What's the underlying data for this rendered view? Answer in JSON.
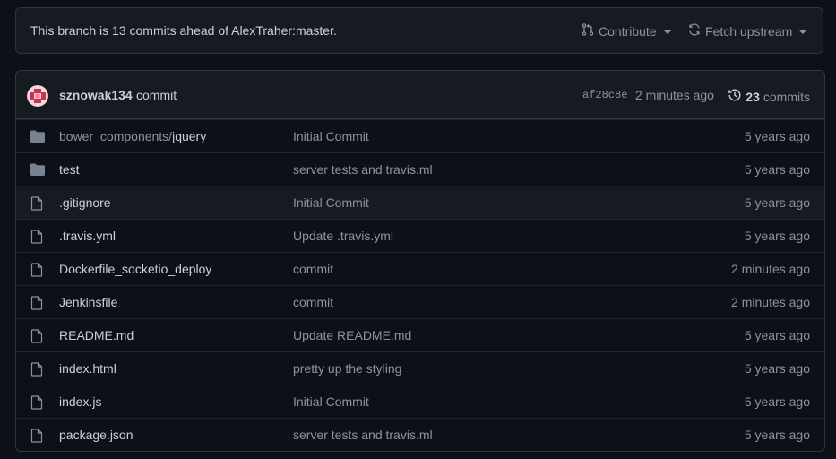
{
  "branch": {
    "status_text": "This branch is 13 commits ahead of AlexTraher:master.",
    "contribute_label": "Contribute",
    "fetch_label": "Fetch upstream"
  },
  "latest_commit": {
    "author": "sznowak134",
    "message": "commit",
    "sha": "af28c8e",
    "time": "2 minutes ago",
    "commit_count": "23",
    "commits_label": "commits"
  },
  "files": [
    {
      "type": "folder",
      "name_prefix": "bower_components/",
      "name": "jquery",
      "message": "Initial Commit",
      "age": "5 years ago"
    },
    {
      "type": "folder",
      "name_prefix": "",
      "name": "test",
      "message": "server tests and travis.ml",
      "age": "5 years ago"
    },
    {
      "type": "file",
      "name_prefix": "",
      "name": ".gitignore",
      "message": "Initial Commit",
      "age": "5 years ago"
    },
    {
      "type": "file",
      "name_prefix": "",
      "name": ".travis.yml",
      "message": "Update .travis.yml",
      "age": "5 years ago"
    },
    {
      "type": "file",
      "name_prefix": "",
      "name": "Dockerfile_socketio_deploy",
      "message": "commit",
      "age": "2 minutes ago"
    },
    {
      "type": "file",
      "name_prefix": "",
      "name": "Jenkinsfile",
      "message": "commit",
      "age": "2 minutes ago"
    },
    {
      "type": "file",
      "name_prefix": "",
      "name": "README.md",
      "message": "Update README.md",
      "age": "5 years ago"
    },
    {
      "type": "file",
      "name_prefix": "",
      "name": "index.html",
      "message": "pretty up the styling",
      "age": "5 years ago"
    },
    {
      "type": "file",
      "name_prefix": "",
      "name": "index.js",
      "message": "Initial Commit",
      "age": "5 years ago"
    },
    {
      "type": "file",
      "name_prefix": "",
      "name": "package.json",
      "message": "server tests and travis.ml",
      "age": "5 years ago"
    }
  ],
  "icons": {
    "folder": "folder-icon",
    "file": "file-icon",
    "contribute": "pull-request-icon",
    "fetch": "sync-icon",
    "history": "history-icon"
  },
  "colors": {
    "background": "#0d1117",
    "panel": "#161b22",
    "border": "#30363d",
    "text": "#c9d1d9",
    "muted": "#8b949e",
    "folder": "#768390"
  }
}
